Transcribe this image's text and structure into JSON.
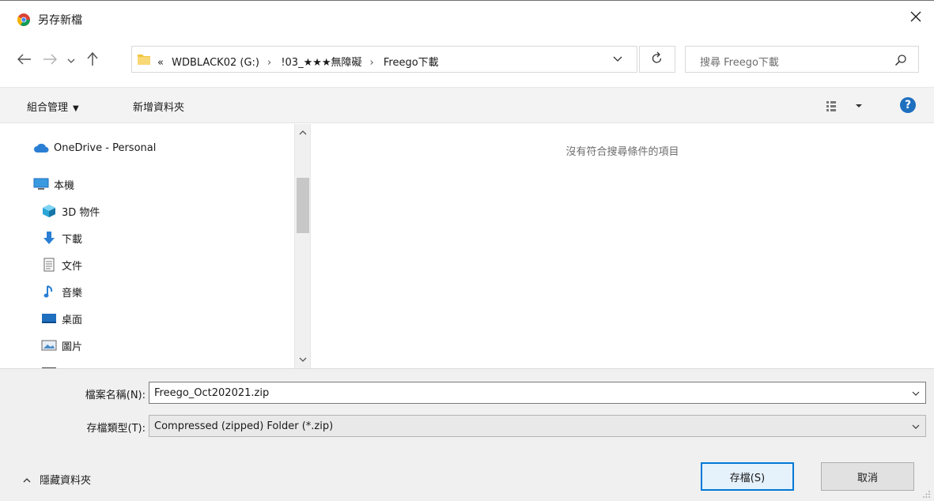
{
  "window": {
    "title": "另存新檔",
    "app_icon": "chrome-icon",
    "close_icon": "close-icon"
  },
  "navigation": {
    "back_icon": "arrow-left-icon",
    "forward_icon": "arrow-right-icon",
    "recent_icon": "chevron-down-icon",
    "up_icon": "arrow-up-icon",
    "breadcrumb_prefix": "«",
    "breadcrumbs": [
      "WDBLACK02 (G:)",
      "!03_★★★無障礙",
      "Freego下載"
    ],
    "refresh_icon": "refresh-icon",
    "search_placeholder": "搜尋 Freego下載"
  },
  "toolbar": {
    "organize_label": "組合管理",
    "new_folder_label": "新增資料夾",
    "views_icon": "view-options-icon",
    "help_label": "?"
  },
  "sidebar": {
    "items": [
      {
        "label": "OneDrive - Personal",
        "icon": "cloud-icon"
      },
      {
        "label": "本機",
        "icon": "computer-icon"
      },
      {
        "label": "3D 物件",
        "icon": "cube-icon"
      },
      {
        "label": "下載",
        "icon": "download-icon"
      },
      {
        "label": "文件",
        "icon": "document-icon"
      },
      {
        "label": "音樂",
        "icon": "music-icon"
      },
      {
        "label": "桌面",
        "icon": "desktop-icon"
      },
      {
        "label": "圖片",
        "icon": "picture-icon"
      }
    ]
  },
  "main": {
    "empty_message": "沒有符合搜尋條件的項目"
  },
  "form": {
    "filename_label": "檔案名稱(N):",
    "filename_value": "Freego_Oct202021.zip",
    "filetype_label": "存檔類型(T):",
    "filetype_value": "Compressed (zipped) Folder (*.zip)"
  },
  "footer": {
    "hide_folders_label": "隱藏資料夾",
    "save_label": "存檔(S)",
    "cancel_label": "取消"
  },
  "colors": {
    "accent": "#0078d7",
    "help_blue": "#1f6fbf",
    "folder_yellow": "#f2c53d",
    "cloud_blue": "#2a7fd4"
  }
}
